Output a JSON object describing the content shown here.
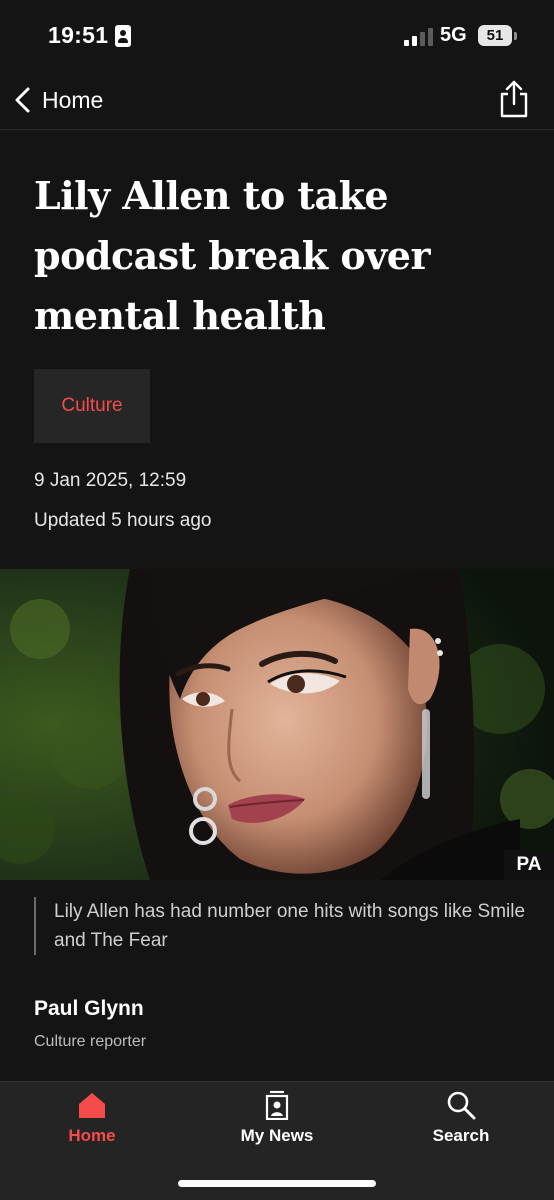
{
  "status_bar": {
    "time": "19:51",
    "network": "5G",
    "battery": "51"
  },
  "nav": {
    "back_label": "Home",
    "icons": [
      "chevron-left-icon",
      "share-icon"
    ]
  },
  "article": {
    "headline": "Lily Allen to take podcast break over mental health",
    "tag": "Culture",
    "date": "9 Jan 2025, 12:59",
    "updated": "Updated 5 hours ago",
    "image_credit": "PA",
    "caption": "Lily Allen has had number one hits with songs like Smile and The Fear",
    "author": "Paul Glynn",
    "author_role": "Culture reporter"
  },
  "tabs": [
    {
      "label": "Home",
      "icon": "home-icon",
      "active": true
    },
    {
      "label": "My News",
      "icon": "my-news-icon",
      "active": false
    },
    {
      "label": "Search",
      "icon": "search-icon",
      "active": false
    }
  ],
  "colors": {
    "background": "#141414",
    "accent": "#f54b4b",
    "tag_bg": "#262626",
    "tab_bar_bg": "#242424"
  }
}
